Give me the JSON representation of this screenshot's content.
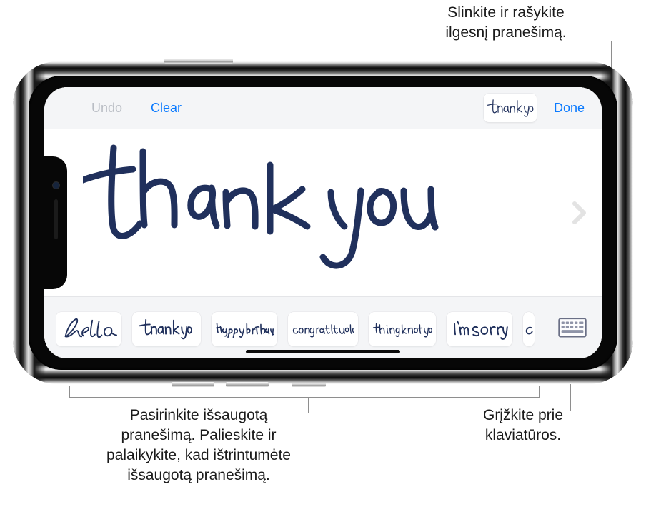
{
  "callouts": {
    "top_right": "Slinkite ir rašykite\nilgesnį pranešimą.",
    "bottom_left": "Pasirinkite išsaugotą\npranešimą. Palieskite ir\npalaikykite, kad ištrintumėte\nišsaugotą pranešimą.",
    "bottom_right": "Grįžkite prie\nklaviatūros."
  },
  "toolbar": {
    "undo_label": "Undo",
    "clear_label": "Clear",
    "done_label": "Done",
    "current_note_text": "thank you"
  },
  "canvas": {
    "handwriting_text": "thank you",
    "next_chevron_icon": "chevron-right-icon"
  },
  "saved_messages": {
    "items": [
      {
        "text": "hello",
        "style": "script"
      },
      {
        "text": "thank you",
        "style": "print"
      },
      {
        "text": "happy birthday.",
        "style": "slant"
      },
      {
        "text": "congratulations",
        "style": "print-small"
      },
      {
        "text": "thinking of you",
        "style": "print-small"
      },
      {
        "text": "I'm sorry",
        "style": "print"
      },
      {
        "text": "c",
        "style": "partial"
      }
    ],
    "keyboard_button_icon": "keyboard-icon"
  },
  "colors": {
    "accent_blue": "#0A7AFF",
    "disabled_grey": "#B9BDC4",
    "ink_navy": "#20305C",
    "toolbar_bg": "#F4F5F7",
    "leader_line": "#8E8E8E"
  }
}
